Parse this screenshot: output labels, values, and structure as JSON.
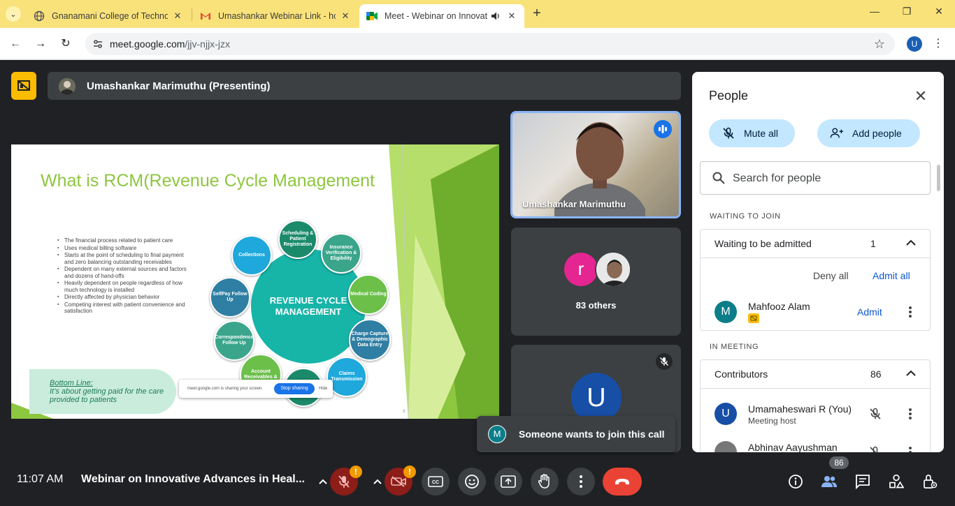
{
  "browser": {
    "tabs": [
      {
        "title": "Gnanamani College of Technolo",
        "active": false
      },
      {
        "title": "Umashankar Webinar Link - hod",
        "active": false
      },
      {
        "title": "Meet - Webinar on Innovati",
        "active": true
      }
    ],
    "url_host": "meet.google.com",
    "url_path": "/jjv-njjx-jzx",
    "profile_initial": "U"
  },
  "meet": {
    "presenter_label": "Umashankar Marimuthu (Presenting)",
    "slide": {
      "title": "What is RCM(Revenue Cycle Management",
      "bullets": [
        "The financial process related to patient care",
        "Uses medical billing software",
        "Starts at the point of scheduling  to final payment and zero balancing outstanding receivables",
        "Dependent on many external sources and factors and dozens of hand-offs",
        "Heavily dependent on people regardless of how much technology is installed",
        "Directly affected by physician behavior",
        "Competing  interest with patient convenience and satisfaction"
      ],
      "center_label": "REVENUE CYCLE MANAGEMENT",
      "cycle_steps": {
        "scheduling": "Scheduling & Patient Registration",
        "insurance": "Insurance Verification & Eligibility",
        "coding": "Medical Coding",
        "charge": "Charge Capture & Demographic Data Entry",
        "claims": "Claims Transmission",
        "account": "Account Receivables &",
        "correspondence": "Correspondence Follow Up",
        "selfpay": "SelfPay Follow Up",
        "collections": "Collections"
      },
      "bottom_line_title": "Bottom Line:",
      "bottom_line_text": "It’s about getting paid for the care provided to patients",
      "share_notice": "meet.google.com is sharing your screen.",
      "stop_sharing": "Stop sharing",
      "hide": "Hide",
      "page_number": "3"
    },
    "speaker_tile_name": "Umashankar Marimuthu",
    "others_avatar_initial": "r",
    "others_label": "83 others",
    "self_tile_initial": "U",
    "toast": {
      "initial": "M",
      "text": "Someone wants to join this call"
    },
    "time": "11:07 AM",
    "meeting_title": "Webinar on Innovative Advances in Heal...",
    "participant_badge": "86",
    "warning_mark": "!"
  },
  "people_panel": {
    "title": "People",
    "mute_all": "Mute all",
    "add_people": "Add people",
    "search_placeholder": "Search for people",
    "waiting_section": "WAITING TO JOIN",
    "waiting_group": "Waiting to be admitted",
    "waiting_count": "1",
    "deny_all": "Deny all",
    "admit_all": "Admit all",
    "waiting_person": {
      "initial": "M",
      "name": "Mahfooz Alam",
      "admit": "Admit"
    },
    "in_meeting_section": "IN MEETING",
    "contributors_group": "Contributors",
    "contributors_count": "86",
    "members": [
      {
        "initial": "U",
        "name": "Umamaheswari R (You)",
        "role": "Meeting host"
      },
      {
        "initial": "",
        "name": "Abhinav Aayushman",
        "role": ""
      }
    ]
  },
  "colors": {
    "meet_bg": "#202124",
    "accent_blue": "#0b57d0",
    "tab_strip": "#f9e27a",
    "end_call": "#ea4335",
    "slide_title_green": "#8dc63f"
  }
}
